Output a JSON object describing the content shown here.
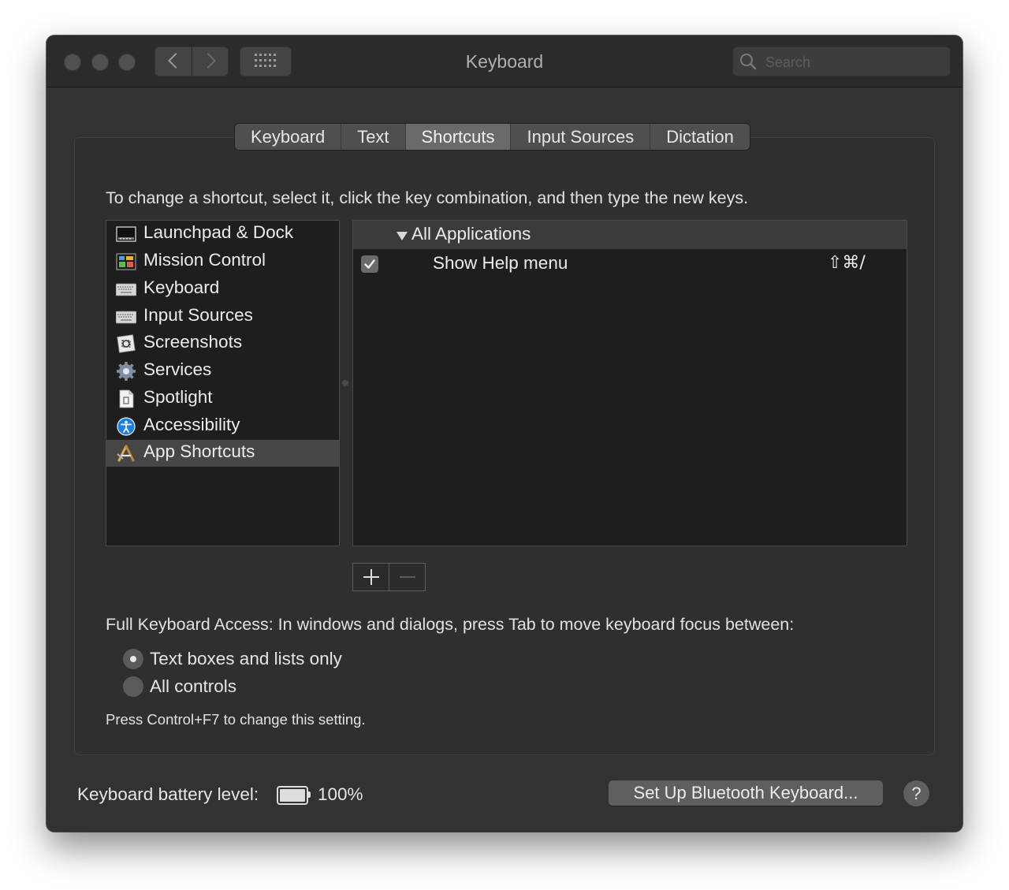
{
  "window": {
    "title": "Keyboard",
    "search_placeholder": "Search"
  },
  "tabs": [
    {
      "label": "Keyboard",
      "active": false
    },
    {
      "label": "Text",
      "active": false
    },
    {
      "label": "Shortcuts",
      "active": true
    },
    {
      "label": "Input Sources",
      "active": false
    },
    {
      "label": "Dictation",
      "active": false
    }
  ],
  "instruction": "To change a shortcut, select it, click the key combination, and then type the new keys.",
  "categories": [
    {
      "label": "Launchpad & Dock",
      "icon": "launchpad-dock-icon"
    },
    {
      "label": "Mission Control",
      "icon": "mission-control-icon"
    },
    {
      "label": "Keyboard",
      "icon": "keyboard-icon"
    },
    {
      "label": "Input Sources",
      "icon": "input-sources-icon"
    },
    {
      "label": "Screenshots",
      "icon": "screenshots-icon"
    },
    {
      "label": "Services",
      "icon": "services-gear-icon"
    },
    {
      "label": "Spotlight",
      "icon": "spotlight-document-icon"
    },
    {
      "label": "Accessibility",
      "icon": "accessibility-icon"
    },
    {
      "label": "App Shortcuts",
      "icon": "app-shortcuts-icon",
      "selected": true
    }
  ],
  "shortcuts": {
    "group": "All Applications",
    "items": [
      {
        "name": "Show Help menu",
        "keys": "⇧⌘/",
        "checked": true
      }
    ]
  },
  "full_keyboard_access": {
    "label": "Full Keyboard Access: In windows and dialogs, press Tab to move keyboard focus between:",
    "options": [
      {
        "label": "Text boxes and lists only",
        "selected": true
      },
      {
        "label": "All controls",
        "selected": false
      }
    ],
    "hint": "Press Control+F7 to change this setting."
  },
  "footer": {
    "battery_label": "Keyboard battery level:",
    "battery_value": "100%",
    "battery_fraction": 1.0,
    "bluetooth_button": "Set Up Bluetooth Keyboard...",
    "help_button": "?"
  }
}
